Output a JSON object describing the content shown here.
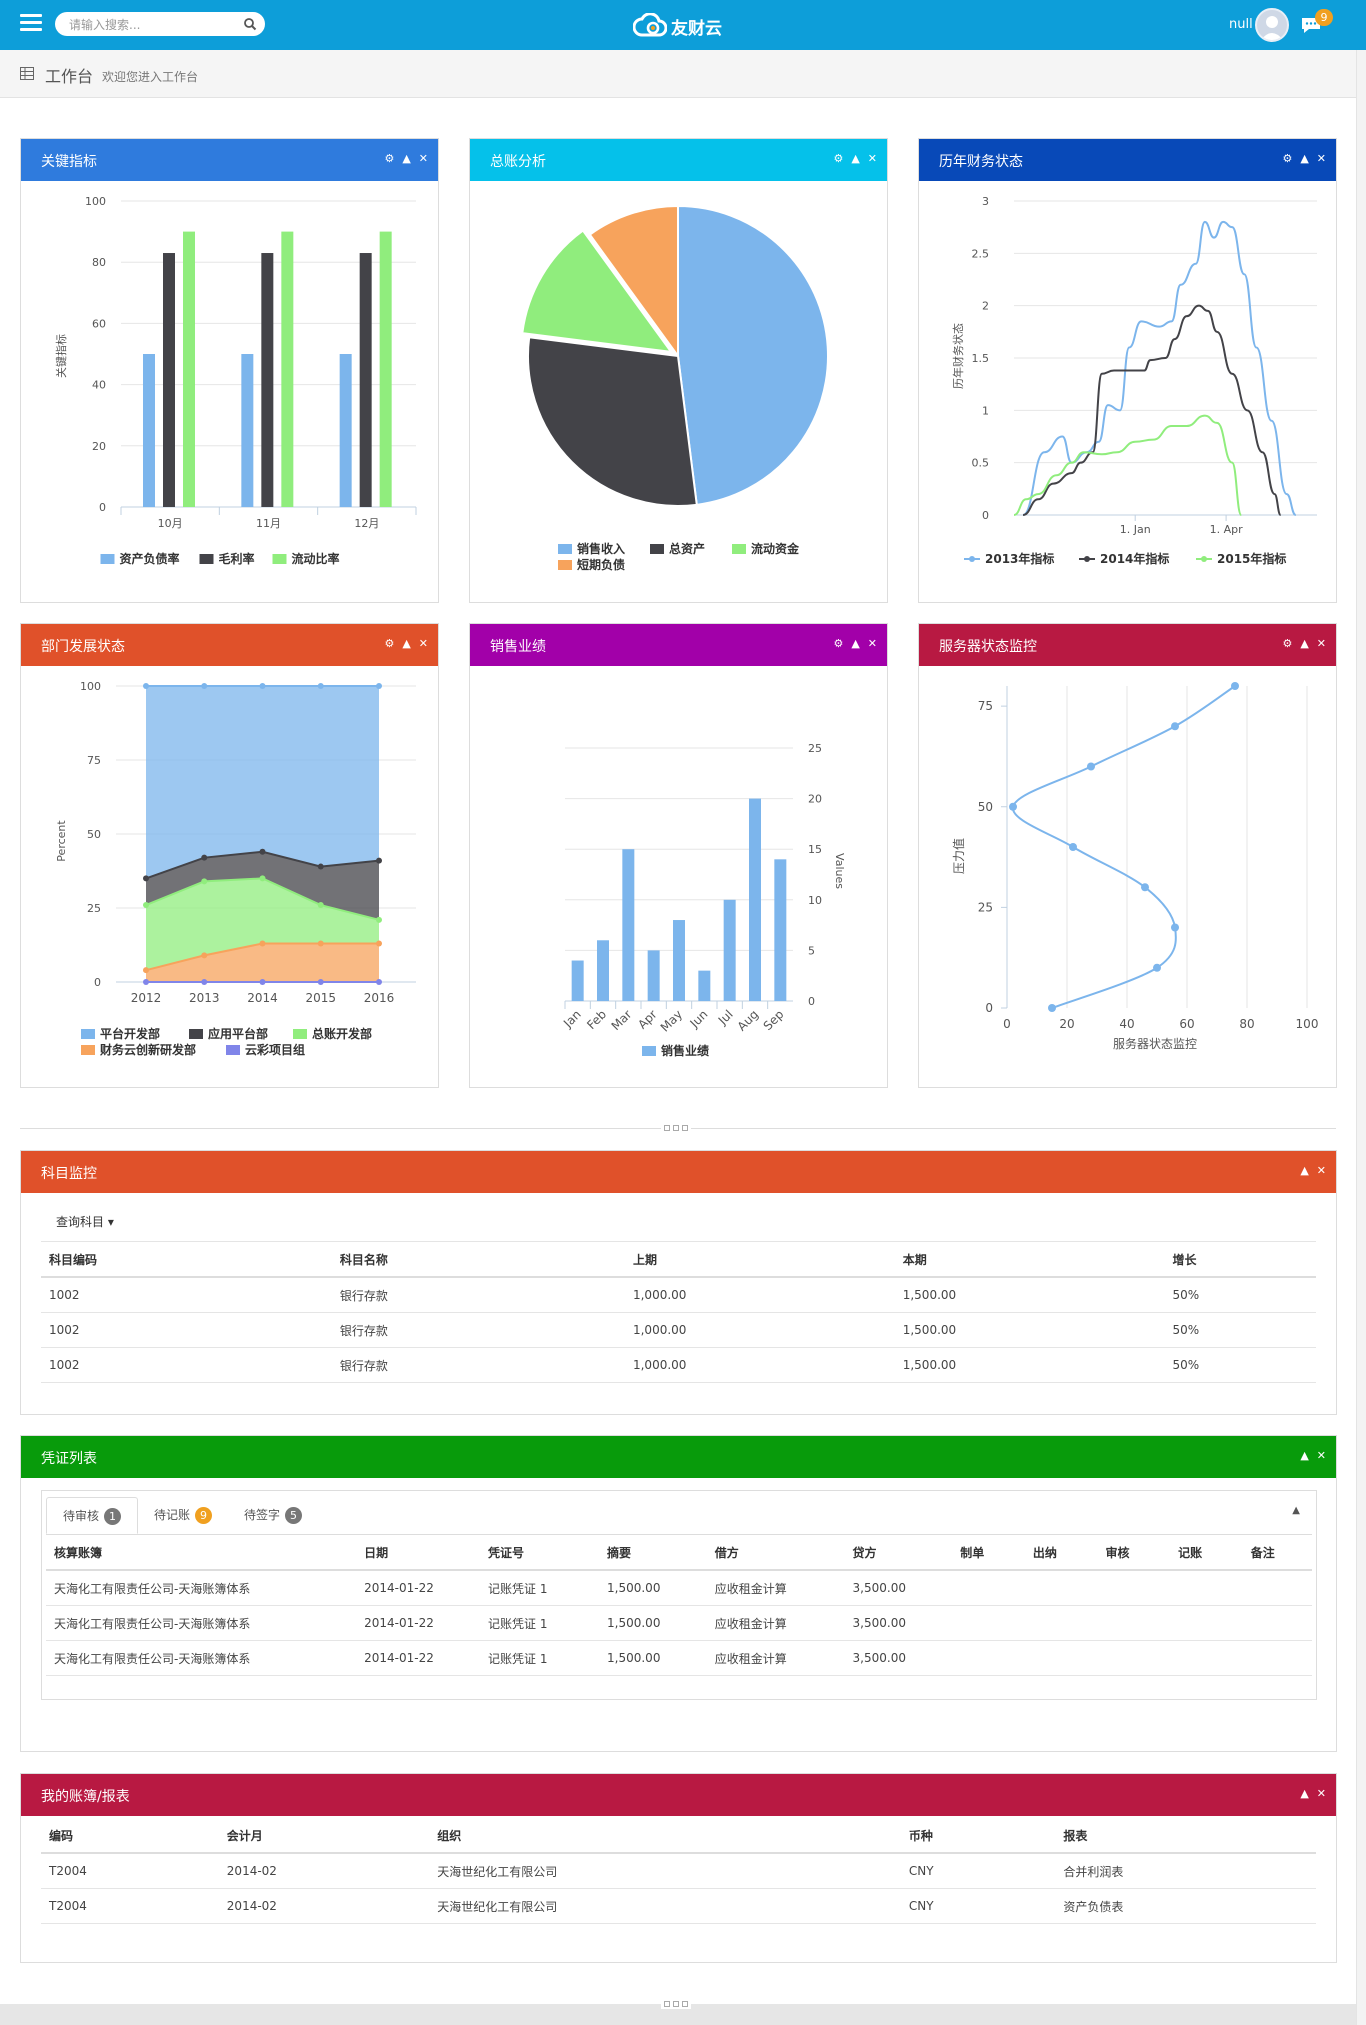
{
  "header": {
    "search_placeholder": "请输入搜索...",
    "logo_text": "友财云",
    "user_name": "null",
    "message_count": "9",
    "brand_color": "#0d9ed9"
  },
  "breadcrumb": {
    "title": "工作台",
    "subtitle": "欢迎您进入工作台"
  },
  "panels": {
    "kpi": {
      "title": "关键指标",
      "color": "#2f7bdd"
    },
    "ledger": {
      "title": "总账分析",
      "color": "#05c1ea"
    },
    "history": {
      "title": "历年财务状态",
      "color": "#0849b8"
    },
    "dept": {
      "title": "部门发展状态",
      "color": "#e0512a"
    },
    "sales": {
      "title": "销售业绩",
      "color": "#a200a9"
    },
    "server": {
      "title": "服务器状态监控",
      "color": "#b81942"
    },
    "subjects": {
      "title": "科目监控",
      "color": "#e0512a"
    },
    "vouchers": {
      "title": "凭证列表",
      "color": "#089b0b"
    },
    "books": {
      "title": "我的账簿/报表",
      "color": "#b81942"
    }
  },
  "chart_data": [
    {
      "type": "bar",
      "categories": [
        "10月",
        "11月",
        "12月"
      ],
      "ylabel": "关键指标",
      "ylim": [
        0,
        100
      ],
      "yticks": [
        0,
        20,
        40,
        60,
        80,
        100
      ],
      "series": [
        {
          "name": "资产负债率",
          "values": [
            50,
            50,
            50
          ],
          "color": "#7cb5ec"
        },
        {
          "name": "毛利率",
          "values": [
            83,
            83,
            83
          ],
          "color": "#434348"
        },
        {
          "name": "流动比率",
          "values": [
            90,
            90,
            90
          ],
          "color": "#90ed7d"
        }
      ]
    },
    {
      "type": "pie",
      "slices": [
        {
          "name": "销售收入",
          "value": 48,
          "color": "#7cb5ec"
        },
        {
          "name": "总资产",
          "value": 29,
          "color": "#434348"
        },
        {
          "name": "流动资金",
          "value": 13,
          "color": "#90ed7d"
        },
        {
          "name": "短期负债",
          "value": 10,
          "color": "#f7a35c"
        }
      ]
    },
    {
      "type": "line",
      "ylabel": "历年财务状态",
      "ylim": [
        0,
        3
      ],
      "yticks": [
        0,
        0.5,
        1,
        1.5,
        2,
        2.5,
        3
      ],
      "xrange": [
        0,
        100
      ],
      "xticks": [
        {
          "x": 40,
          "label": "1. Jan"
        },
        {
          "x": 70,
          "label": "1. Apr"
        }
      ],
      "series": [
        {
          "name": "2013年指标",
          "color": "#7cb5ec",
          "points": [
            [
              3,
              0
            ],
            [
              10,
              0.6
            ],
            [
              16,
              0.75
            ],
            [
              19,
              0.5
            ],
            [
              24,
              0.6
            ],
            [
              28,
              0.7
            ],
            [
              31,
              1.05
            ],
            [
              35,
              1.0
            ],
            [
              38,
              1.6
            ],
            [
              42,
              1.85
            ],
            [
              48,
              1.8
            ],
            [
              52,
              1.85
            ],
            [
              55,
              2.2
            ],
            [
              60,
              2.4
            ],
            [
              63,
              2.8
            ],
            [
              66,
              2.65
            ],
            [
              69,
              2.8
            ],
            [
              72,
              2.75
            ],
            [
              76,
              2.3
            ],
            [
              80,
              1.6
            ],
            [
              85,
              0.9
            ],
            [
              90,
              0.2
            ],
            [
              93,
              0
            ]
          ]
        },
        {
          "name": "2014年指标",
          "color": "#434348",
          "points": [
            [
              3,
              0
            ],
            [
              8,
              0.15
            ],
            [
              13,
              0.3
            ],
            [
              19,
              0.4
            ],
            [
              22,
              0.5
            ],
            [
              26,
              0.6
            ],
            [
              29,
              1.35
            ],
            [
              33,
              1.38
            ],
            [
              38,
              1.38
            ],
            [
              43,
              1.38
            ],
            [
              45,
              1.48
            ],
            [
              50,
              1.5
            ],
            [
              53,
              1.68
            ],
            [
              57,
              1.9
            ],
            [
              61,
              2.0
            ],
            [
              64,
              1.95
            ],
            [
              67,
              1.75
            ],
            [
              72,
              1.35
            ],
            [
              77,
              1.0
            ],
            [
              82,
              0.6
            ],
            [
              86,
              0.2
            ],
            [
              88,
              0
            ]
          ]
        },
        {
          "name": "2015年指标",
          "color": "#90ed7d",
          "points": [
            [
              0,
              0
            ],
            [
              4,
              0.15
            ],
            [
              8,
              0.2
            ],
            [
              14,
              0.38
            ],
            [
              19,
              0.5
            ],
            [
              23,
              0.6
            ],
            [
              29,
              0.58
            ],
            [
              34,
              0.6
            ],
            [
              40,
              0.7
            ],
            [
              46,
              0.72
            ],
            [
              52,
              0.85
            ],
            [
              57,
              0.85
            ],
            [
              63,
              0.95
            ],
            [
              67,
              0.88
            ],
            [
              72,
              0.5
            ],
            [
              75,
              0
            ]
          ]
        }
      ]
    },
    {
      "type": "area",
      "categories": [
        "2012",
        "2013",
        "2014",
        "2015",
        "2016"
      ],
      "ylabel": "Percent",
      "ylim": [
        0,
        100
      ],
      "yticks": [
        0,
        25,
        50,
        75,
        100
      ],
      "series": [
        {
          "name": "平台开发部",
          "values": [
            100,
            100,
            100,
            100,
            100
          ],
          "color": "#7cb5ec"
        },
        {
          "name": "应用平台部",
          "values": [
            35,
            42,
            44,
            39,
            41
          ],
          "color": "#434348"
        },
        {
          "name": "总账开发部",
          "values": [
            26,
            34,
            35,
            26,
            21
          ],
          "color": "#90ed7d"
        },
        {
          "name": "财务云创新研发部",
          "values": [
            4,
            9,
            13,
            13,
            13
          ],
          "color": "#f7a35c"
        },
        {
          "name": "云彩项目组",
          "values": [
            0,
            0,
            0,
            0,
            0
          ],
          "color": "#8085e9"
        }
      ]
    },
    {
      "type": "bar",
      "categories": [
        "Jan",
        "Feb",
        "Mar",
        "Apr",
        "May",
        "Jun",
        "Jul",
        "Aug",
        "Sep"
      ],
      "ylabel": "Values",
      "ylim": [
        0,
        25
      ],
      "yticks": [
        0,
        5,
        10,
        15,
        20,
        25
      ],
      "series": [
        {
          "name": "销售业绩",
          "values": [
            4,
            6,
            15,
            5,
            8,
            3,
            10,
            20,
            14
          ],
          "color": "#7cb5ec"
        }
      ]
    },
    {
      "type": "scatter",
      "xlabel": "服务器状态监控",
      "ylabel": "压力值",
      "xlim": [
        0,
        100
      ],
      "ylim": [
        0,
        80
      ],
      "xticks": [
        0,
        20,
        40,
        60,
        80,
        100
      ],
      "yticks": [
        0,
        25,
        50,
        75
      ],
      "series": [
        {
          "name": "",
          "color": "#7cb5ec",
          "points": [
            [
              15,
              0
            ],
            [
              50,
              10
            ],
            [
              56,
              20
            ],
            [
              46,
              30
            ],
            [
              22,
              40
            ],
            [
              2,
              50
            ],
            [
              28,
              60
            ],
            [
              56,
              70
            ],
            [
              76,
              80
            ]
          ]
        }
      ]
    }
  ],
  "subjects": {
    "query_label": "查询科目",
    "columns": [
      "科目编码",
      "科目名称",
      "上期",
      "本期",
      "增长"
    ],
    "rows": [
      [
        "1002",
        "银行存款",
        "1,000.00",
        "1,500.00",
        "50%"
      ],
      [
        "1002",
        "银行存款",
        "1,000.00",
        "1,500.00",
        "50%"
      ],
      [
        "1002",
        "银行存款",
        "1,000.00",
        "1,500.00",
        "50%"
      ]
    ]
  },
  "vouchers": {
    "tabs": [
      {
        "label": "待审核",
        "count": "1",
        "color": "#777777"
      },
      {
        "label": "待记账",
        "count": "9",
        "color": "#f0a020"
      },
      {
        "label": "待签字",
        "count": "5",
        "color": "#777777"
      }
    ],
    "columns": [
      "核算账簿",
      "日期",
      "凭证号",
      "摘要",
      "借方",
      "贷方",
      "制单",
      "出纳",
      "审核",
      "记账",
      "备注"
    ],
    "rows": [
      [
        "天海化工有限责任公司-天海账簿体系",
        "2014-01-22",
        "记账凭证 1",
        "1,500.00",
        "应收租金计算",
        "3,500.00",
        "",
        "",
        "",
        "",
        ""
      ],
      [
        "天海化工有限责任公司-天海账簿体系",
        "2014-01-22",
        "记账凭证 1",
        "1,500.00",
        "应收租金计算",
        "3,500.00",
        "",
        "",
        "",
        "",
        ""
      ],
      [
        "天海化工有限责任公司-天海账簿体系",
        "2014-01-22",
        "记账凭证 1",
        "1,500.00",
        "应收租金计算",
        "3,500.00",
        "",
        "",
        "",
        "",
        ""
      ]
    ]
  },
  "books": {
    "columns": [
      "编码",
      "会计月",
      "组织",
      "币种",
      "报表"
    ],
    "rows": [
      [
        "T2004",
        "2014-02",
        "天海世纪化工有限公司",
        "CNY",
        "合并利润表"
      ],
      [
        "T2004",
        "2014-02",
        "天海世纪化工有限公司",
        "CNY",
        "资产负债表"
      ]
    ]
  }
}
